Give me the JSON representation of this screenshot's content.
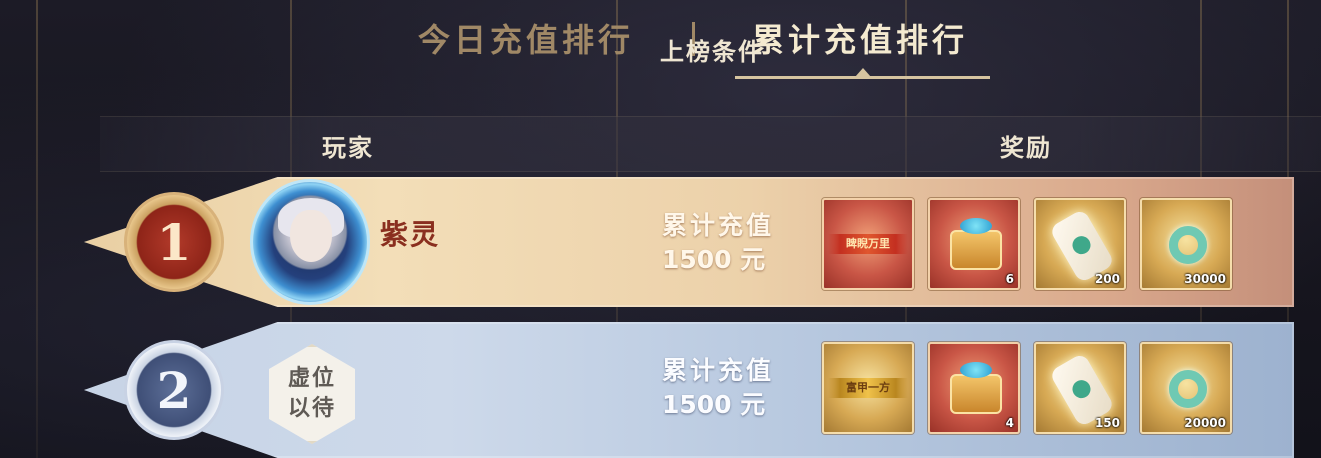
{
  "tabs": {
    "daily": "今日充值排行",
    "total": "累计充值排行",
    "active": "total"
  },
  "columns": {
    "player": "玩家",
    "condition": "上榜条件",
    "reward": "奖励"
  },
  "ranks": [
    {
      "rank": "1",
      "player_name": "紫灵",
      "condition_label": "累计充值",
      "condition_amount": "1500 元",
      "rewards": [
        {
          "icon": "title-card-red",
          "banner": "睥睨万里",
          "count": ""
        },
        {
          "icon": "treasure-chest",
          "count": "6"
        },
        {
          "icon": "jade-scroll",
          "count": "200"
        },
        {
          "icon": "jade-ring",
          "count": "30000"
        }
      ]
    },
    {
      "rank": "2",
      "placeholder": [
        "虚位",
        "以待"
      ],
      "condition_label": "累计充值",
      "condition_amount": "1500 元",
      "rewards": [
        {
          "icon": "title-card-gold",
          "banner": "富甲一方",
          "count": ""
        },
        {
          "icon": "treasure-chest",
          "count": "4"
        },
        {
          "icon": "jade-scroll",
          "count": "150"
        },
        {
          "icon": "jade-ring",
          "count": "20000"
        }
      ]
    }
  ],
  "colors": {
    "tab_active": "#f4ead0",
    "tab_inactive": "#a08866",
    "rank1_name": "#8a2f1f"
  }
}
